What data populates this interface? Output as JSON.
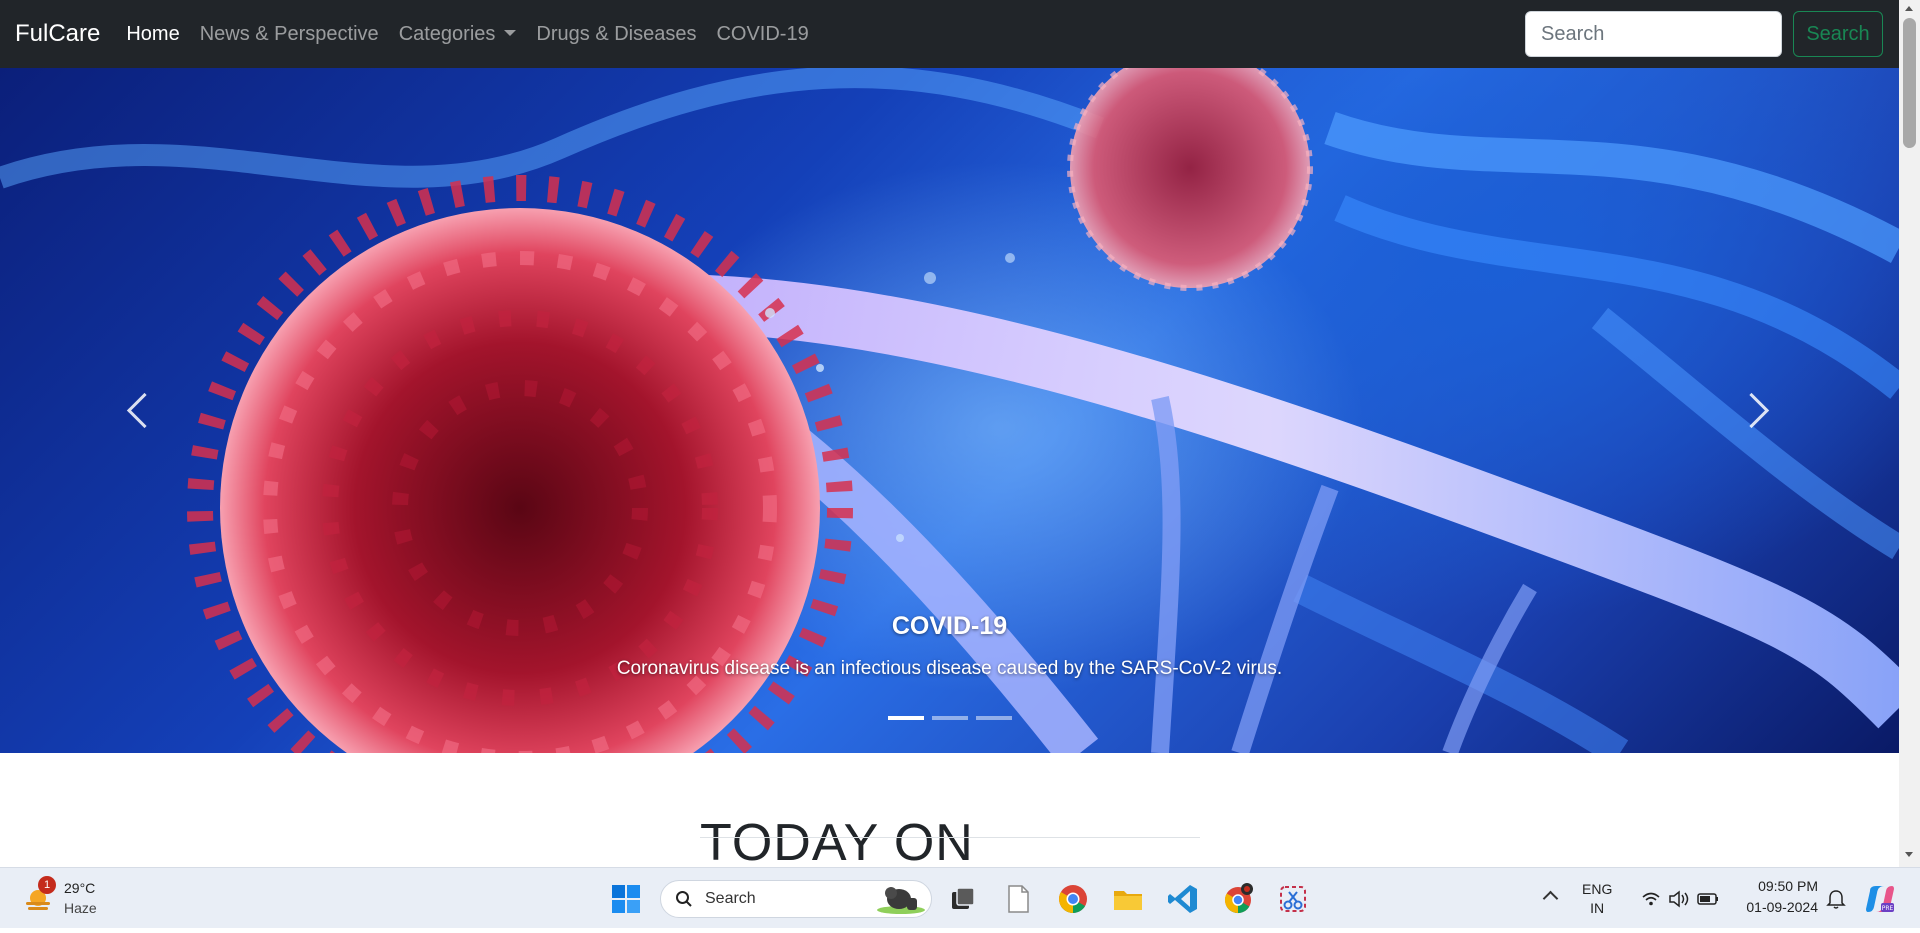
{
  "navbar": {
    "brand": "FulCare",
    "links": [
      "Home",
      "News & Perspective",
      "Categories",
      "Drugs & Diseases",
      "COVID-19"
    ],
    "active_link": "Home",
    "search_placeholder": "Search",
    "search_button": "Search"
  },
  "carousel": {
    "slide_title": "COVID-19",
    "slide_text": "Coronavirus disease is an infectious disease caused by the SARS-CoV-2 virus.",
    "slide_count": 3,
    "active_slide": 1
  },
  "section": {
    "title": "TODAY ON FULCARE"
  },
  "taskbar": {
    "weather": {
      "temperature": "29°C",
      "condition": "Haze",
      "badge": "1"
    },
    "search_label": "Search",
    "apps": [
      "task-view",
      "notepad",
      "chrome",
      "file-explorer",
      "vs-code",
      "chrome-profile",
      "snipping-tool"
    ],
    "language": {
      "line1": "ENG",
      "line2": "IN"
    },
    "time": "09:50 PM",
    "date": "01-09-2024"
  },
  "colors": {
    "navbar_bg": "#212529",
    "search_button": "#198754",
    "accent": "#0067c0"
  }
}
